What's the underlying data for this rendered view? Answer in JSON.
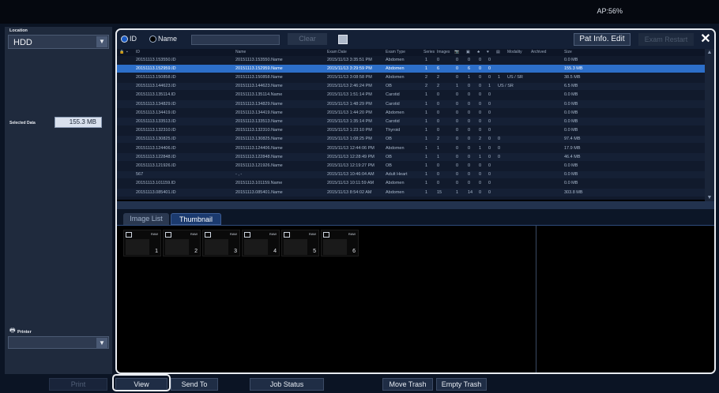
{
  "topbar": {
    "ap": "AP:56%"
  },
  "left": {
    "location_label": "Location",
    "location_value": "HDD",
    "selected_label": "Selected Data",
    "selected_value": "155.3 MB",
    "printer_label": "Printer",
    "printer_value": ""
  },
  "toolbar": {
    "radio_id": "ID",
    "radio_name": "Name",
    "name_input_value": "",
    "clear": "Clear",
    "pat_info_edit": "Pat Info. Edit",
    "exam_restart": "Exam Restart"
  },
  "table": {
    "headers": [
      "ID",
      "Name",
      "Exam Date",
      "Exam Type",
      "Series",
      "Images",
      "Modality",
      "Archived",
      "Size"
    ],
    "rows": [
      [
        "20151113.153550.ID",
        "20151113.153550.Name",
        "2015/11/13 3:35:51 PM",
        "Abdomen",
        "1",
        "0",
        "0",
        "0",
        "0",
        "0",
        "",
        "",
        "0.0 MB"
      ],
      [
        "20151113.152959.ID",
        "20151113.152959.Name",
        "2015/11/13 3:29:59 PM",
        "Abdomen",
        "1",
        "6",
        "0",
        "6",
        "0",
        "0",
        "",
        "",
        "155.3 MB"
      ],
      [
        "20151113.150858.ID",
        "20151113.150858.Name",
        "2015/11/13 3:08:58 PM",
        "Abdomen",
        "2",
        "2",
        "0",
        "1",
        "0",
        "0",
        "1",
        "US / SR",
        "38.5 MB"
      ],
      [
        "20151113.144623.ID",
        "20151113.144623.Name",
        "2015/11/13 2:46:24 PM",
        "OB",
        "2",
        "2",
        "1",
        "0",
        "0",
        "1",
        "US / SR",
        "",
        "6.5 MB"
      ],
      [
        "20151113.135114.ID",
        "20151113.135114.Name",
        "2015/11/13 1:51:14 PM",
        "Carotid",
        "1",
        "0",
        "0",
        "0",
        "0",
        "0",
        "",
        "",
        "0.0 MB"
      ],
      [
        "20151113.134829.ID",
        "20151113.134829.Name",
        "2015/11/13 1:48:29 PM",
        "Carotid",
        "1",
        "0",
        "0",
        "0",
        "0",
        "0",
        "",
        "",
        "0.0 MB"
      ],
      [
        "20151113.134419.ID",
        "20151113.134419.Name",
        "2015/11/13 1:44:20 PM",
        "Abdomen",
        "1",
        "0",
        "0",
        "0",
        "0",
        "0",
        "",
        "",
        "0.0 MB"
      ],
      [
        "20151113.133513.ID",
        "20151113.133513.Name",
        "2015/11/13 1:35:14 PM",
        "Carotid",
        "1",
        "0",
        "0",
        "0",
        "0",
        "0",
        "",
        "",
        "0.0 MB"
      ],
      [
        "20151113.132310.ID",
        "20151113.132310.Name",
        "2015/11/13 1:23:10 PM",
        "Thyroid",
        "1",
        "0",
        "0",
        "0",
        "0",
        "0",
        "",
        "",
        "0.0 MB"
      ],
      [
        "20151113.130825.ID",
        "20151113.130825.Name",
        "2015/11/13 1:08:25 PM",
        "OB",
        "1",
        "2",
        "0",
        "0",
        "2",
        "0",
        "0",
        "",
        "97.4 MB"
      ],
      [
        "20151113.124406.ID",
        "20151113.124406.Name",
        "2015/11/13 12:44:06 PM",
        "Abdomen",
        "1",
        "1",
        "0",
        "0",
        "1",
        "0",
        "0",
        "",
        "17.9 MB"
      ],
      [
        "20151113.122848.ID",
        "20151113.122848.Name",
        "2015/11/13 12:28:49 PM",
        "OB",
        "1",
        "1",
        "0",
        "0",
        "1",
        "0",
        "0",
        "",
        "46.4 MB"
      ],
      [
        "20151113.121926.ID",
        "20151113.121926.Name",
        "2015/11/13 12:19:27 PM",
        "OB",
        "1",
        "0",
        "0",
        "0",
        "0",
        "0",
        "",
        "",
        "0.0 MB"
      ],
      [
        "567",
        "- , -",
        "2015/11/13 10:46:04 AM",
        "Adult Heart",
        "1",
        "0",
        "0",
        "0",
        "0",
        "0",
        "",
        "",
        "0.0 MB"
      ],
      [
        "20151113.101159.ID",
        "20151113.101159.Name",
        "2015/11/13 10:11:59 AM",
        "Abdomen",
        "1",
        "0",
        "0",
        "0",
        "0",
        "0",
        "",
        "",
        "0.0 MB"
      ],
      [
        "20151113.085401.ID",
        "20151113.085401.Name",
        "2015/11/13 8:54:02 AM",
        "Abdomen",
        "1",
        "15",
        "1",
        "14",
        "0",
        "0",
        "",
        "",
        "303.8 MB"
      ]
    ]
  },
  "tabs": {
    "image_list": "Image List",
    "thumbnail": "Thumbnail"
  },
  "thumbnails": [
    {
      "raw": "RAW",
      "num": "1"
    },
    {
      "raw": "RAW",
      "num": "2"
    },
    {
      "raw": "RAW",
      "num": "3"
    },
    {
      "raw": "RAW",
      "num": "4"
    },
    {
      "raw": "RAW",
      "num": "5"
    },
    {
      "raw": "RAW",
      "num": "6"
    }
  ],
  "bottom": {
    "print": "Print",
    "view": "View",
    "send_to": "Send To",
    "job_status": "Job Status",
    "move_trash": "Move Trash",
    "empty_trash": "Empty Trash"
  },
  "colors": {
    "selected_row": "#2d6fc9",
    "frame_highlight": "#e9ecf1"
  }
}
